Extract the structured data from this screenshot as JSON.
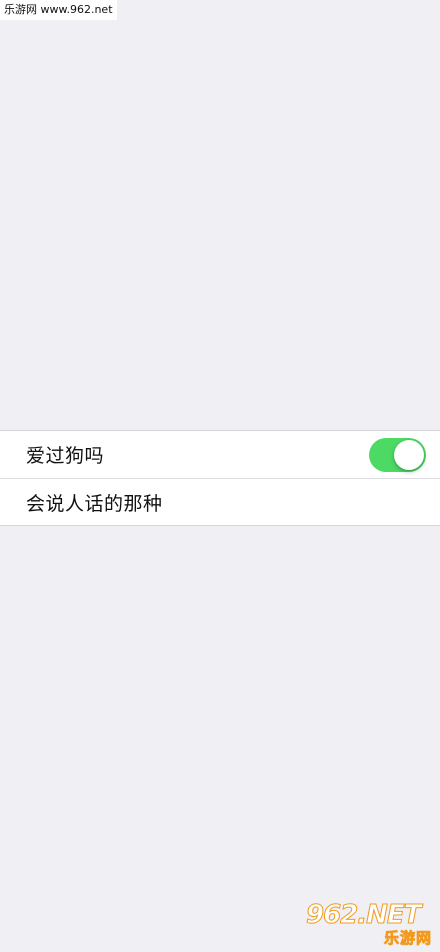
{
  "watermark": {
    "top_text": "乐游网 www.962.net",
    "logo_main": "962.NET",
    "logo_sub": "乐游网"
  },
  "settings": {
    "items": [
      {
        "label": "爱过狗吗",
        "toggle": {
          "on": true
        }
      },
      {
        "label": "会说人话的那种"
      }
    ]
  },
  "colors": {
    "background": "#efeff4",
    "toggle_on": "#4cd964",
    "row_background": "#ffffff"
  }
}
